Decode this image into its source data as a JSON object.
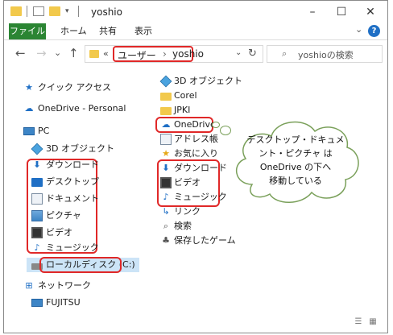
{
  "titlebar": {
    "title": "yoshio",
    "controls": [
      "–",
      "☐",
      "✕"
    ]
  },
  "ribbon": {
    "file_label": "ファイル",
    "tabs": [
      "ホーム",
      "共有",
      "表示"
    ],
    "help": "?",
    "caret": "⌄"
  },
  "nav_buttons": {
    "back": "←",
    "forward": "→",
    "recent": "⌄",
    "up": "↑"
  },
  "address": {
    "chevron": "«",
    "crumbs": [
      "ユーザー",
      "›",
      "yoshio"
    ],
    "dropdown": "⌄",
    "refresh": "↻"
  },
  "search": {
    "icon": "⌕",
    "placeholder": "yoshioの検索"
  },
  "sidebar": {
    "items": [
      {
        "label": "クイック アクセス",
        "icon": "star-icon"
      },
      {
        "label": "OneDrive - Personal",
        "icon": "cloud-icon"
      },
      {
        "label": "PC",
        "icon": "pc-icon"
      },
      {
        "label": "3D オブジェクト",
        "icon": "cube-icon"
      },
      {
        "label": "ダウンロード",
        "icon": "download-icon"
      },
      {
        "label": "デスクトップ",
        "icon": "desktop-icon"
      },
      {
        "label": "ドキュメント",
        "icon": "document-icon"
      },
      {
        "label": "ピクチャ",
        "icon": "picture-icon"
      },
      {
        "label": "ビデオ",
        "icon": "video-icon"
      },
      {
        "label": "ミュージック",
        "icon": "music-icon"
      },
      {
        "label": "ローカルディスク (C:)",
        "icon": "drive-icon"
      },
      {
        "label": "ネットワーク",
        "icon": "network-icon"
      },
      {
        "label": "FUJITSU",
        "icon": "pc-icon"
      }
    ]
  },
  "files": [
    {
      "label": "3D オブジェクト",
      "icon": "cube-icon"
    },
    {
      "label": "Corel",
      "icon": "folder-icon"
    },
    {
      "label": "JPKI",
      "icon": "folder-icon"
    },
    {
      "label": "OneDrive",
      "icon": "cloud-icon"
    },
    {
      "label": "アドレス帳",
      "icon": "contacts-icon"
    },
    {
      "label": "お気に入り",
      "icon": "star-icon"
    },
    {
      "label": "ダウンロード",
      "icon": "download-icon"
    },
    {
      "label": "ビデオ",
      "icon": "video-icon"
    },
    {
      "label": "ミュージック",
      "icon": "music-icon"
    },
    {
      "label": "リンク",
      "icon": "link-icon"
    },
    {
      "label": "検索",
      "icon": "search-icon"
    },
    {
      "label": "保存したゲーム",
      "icon": "game-icon"
    }
  ],
  "callout": {
    "lines": [
      "デスクトップ・ドキュメ",
      "ント・ピクチャ は",
      "OneDrive の下へ",
      "移動している"
    ]
  },
  "colors": {
    "file_tab": "#2b8533",
    "highlight": "#e02828",
    "selection": "#cce4f7",
    "accent": "#1f6fc5"
  }
}
